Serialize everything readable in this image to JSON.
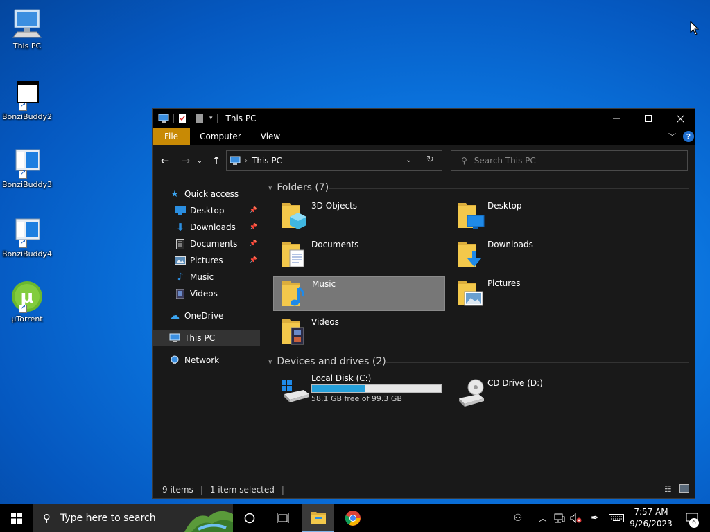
{
  "desktop": {
    "icons": [
      {
        "label": "This PC"
      },
      {
        "label": "BonziBuddy2"
      },
      {
        "label": "BonziBuddy3"
      },
      {
        "label": "BonziBuddy4"
      },
      {
        "label": "µTorrent"
      }
    ]
  },
  "window": {
    "title": "This PC",
    "ribbon": {
      "file": "File",
      "computer": "Computer",
      "view": "View"
    },
    "address": {
      "segment": "This PC"
    },
    "search": {
      "placeholder": "Search This PC"
    },
    "nav": {
      "quick_access": "Quick access",
      "desktop": "Desktop",
      "downloads": "Downloads",
      "documents": "Documents",
      "pictures": "Pictures",
      "music": "Music",
      "videos": "Videos",
      "onedrive": "OneDrive",
      "this_pc": "This PC",
      "network": "Network"
    },
    "groups": {
      "folders_title": "Folders (7)",
      "drives_title": "Devices and drives (2)"
    },
    "folders": [
      {
        "name": "3D Objects"
      },
      {
        "name": "Desktop"
      },
      {
        "name": "Documents"
      },
      {
        "name": "Downloads"
      },
      {
        "name": "Music"
      },
      {
        "name": "Pictures"
      },
      {
        "name": "Videos"
      }
    ],
    "drives": [
      {
        "name": "Local Disk (C:)",
        "free_text": "58.1 GB free of 99.3 GB",
        "used_fraction": 0.415
      },
      {
        "name": "CD Drive (D:)"
      }
    ],
    "status": {
      "items": "9 items",
      "selected": "1 item selected"
    }
  },
  "taskbar": {
    "search_placeholder": "Type here to search",
    "time": "7:57 AM",
    "date": "9/26/2023",
    "notification_count": "6"
  },
  "colors": {
    "accent_file_tab": "#c88a05",
    "progress_fill": "#26a0da",
    "folder_yellow": "#f3c84b"
  }
}
